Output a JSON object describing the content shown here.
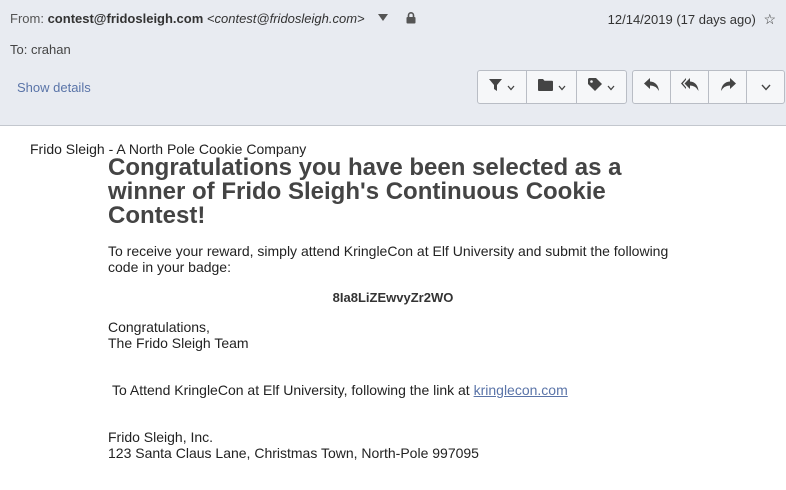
{
  "header": {
    "from_label": "From:",
    "from_address": "contest@fridosleigh.com",
    "from_full": "<contest@fridosleigh.com>",
    "date": "12/14/2019 (17 days ago)",
    "to_label": "To:",
    "to_value": "crahan",
    "show_details": "Show details",
    "icons": {
      "sender_menu": "triangle-down-icon",
      "lock": "lock-icon",
      "star": "star-icon",
      "filter": "filter-icon",
      "folder": "folder-icon",
      "tag": "tag-icon",
      "reply": "reply-icon",
      "reply_all": "reply-all-icon",
      "forward": "forward-icon",
      "more": "chevron-down-icon"
    }
  },
  "email": {
    "company_line": "Frido Sleigh - A North Pole Cookie Company",
    "headline": "Congratulations you have been selected as a winner of Frido Sleigh's Continuous Cookie Contest!",
    "instructions": "To receive your reward, simply attend KringleCon at Elf University and submit the following code in your badge:",
    "code": "8Ia8LiZEwvyZr2WO",
    "sign_off_1": "Congratulations,",
    "sign_off_2": "The Frido Sleigh Team",
    "attend_text": "To Attend KringleCon at Elf University, following the link at ",
    "link_text": "kringlecon.com",
    "footer_1": "Frido Sleigh, Inc.",
    "footer_2": "123 Santa Claus Lane, Christmas Town, North-Pole 997095"
  },
  "colors": {
    "header_bg": "#e8ebf1",
    "link": "#5a74a8",
    "headline": "#444444"
  }
}
